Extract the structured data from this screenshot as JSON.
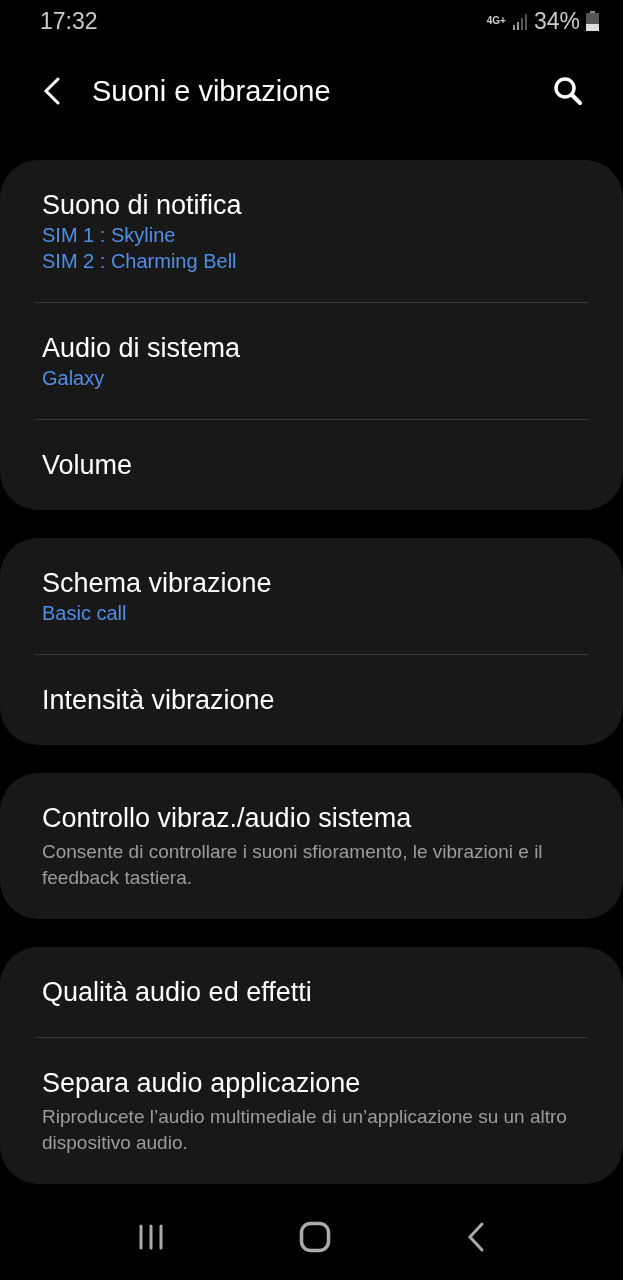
{
  "status_bar": {
    "time": "17:32",
    "network": "4G+",
    "battery_percent": "34%"
  },
  "header": {
    "title": "Suoni e vibrazione"
  },
  "groups": [
    {
      "items": [
        {
          "title": "Suono di notifica",
          "values": [
            "SIM 1 : Skyline",
            "SIM 2 : Charming Bell"
          ]
        },
        {
          "title": "Audio di sistema",
          "values": [
            "Galaxy"
          ]
        },
        {
          "title": "Volume"
        }
      ]
    },
    {
      "items": [
        {
          "title": "Schema vibrazione",
          "values": [
            "Basic call"
          ]
        },
        {
          "title": "Intensità vibrazione"
        }
      ]
    },
    {
      "items": [
        {
          "title": "Controllo vibraz./audio sistema",
          "description": "Consente di controllare i suoni sfioramento, le vibrazioni e il feedback tastiera."
        }
      ]
    },
    {
      "items": [
        {
          "title": "Qualità audio ed effetti"
        },
        {
          "title": "Separa audio applicazione",
          "description": "Riproducete l’audio multimediale di un’applicazione su un altro dispositivo audio."
        }
      ]
    }
  ]
}
